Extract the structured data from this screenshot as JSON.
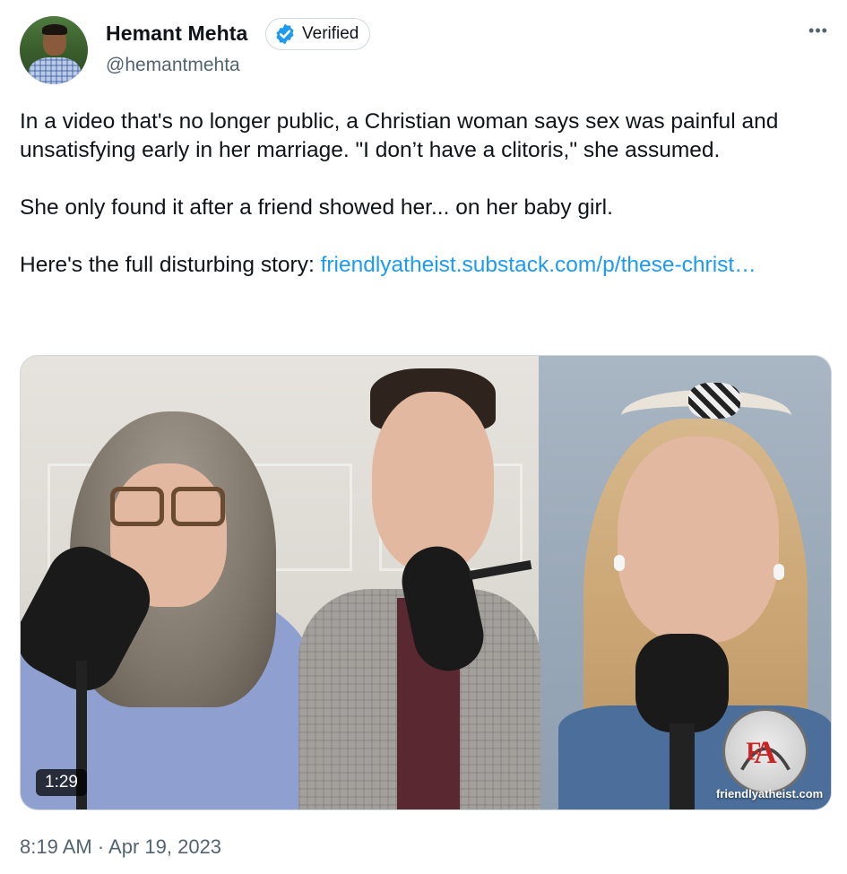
{
  "author": {
    "name": "Hemant Mehta",
    "handle": "@hemantmehta",
    "verified_label": "Verified",
    "avatar_icon": "profile-photo",
    "verified_icon": "verified-badge-icon",
    "verified_color": "#1d9bf0"
  },
  "menu": {
    "more_label": "•••"
  },
  "tweet": {
    "paragraph1": "In a video that's no longer public, a Christian woman says sex was painful and unsatisfying early in her marriage. \"I don’t have a clitoris,\" she assumed.",
    "paragraph2": "She only found it after a friend showed her... on her baby girl.",
    "paragraph3_prefix": "Here's the full disturbing story: ",
    "link_text": "friendlyatheist.substack.com/p/these-christ…",
    "link_color": "#1d9bf0"
  },
  "media": {
    "type": "video",
    "duration": "1:29",
    "watermark_text": "friendlyatheist.com",
    "watermark_logo_icon": "fa-logo"
  },
  "meta": {
    "timestamp": "8:19 AM · Apr 19, 2023"
  }
}
